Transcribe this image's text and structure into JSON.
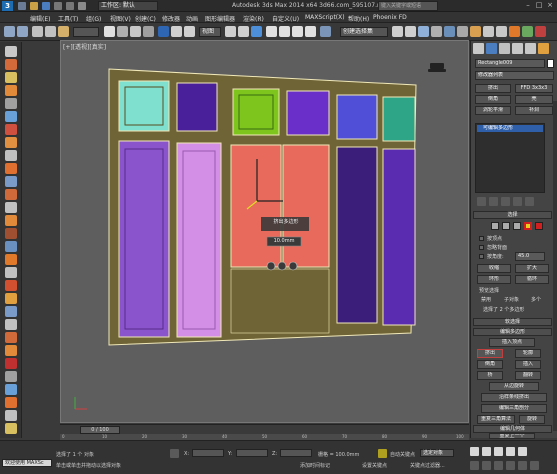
{
  "titlebar": {
    "logo": "3",
    "workspace": "工作区: 默认",
    "title": "Autodesk 3ds Max  2014 x64    3d66.com_595107.max",
    "search": "键入关键字或短语",
    "min": "–",
    "max": "□",
    "close": "×"
  },
  "menu": [
    "编辑(E)",
    "工具(T)",
    "组(G)",
    "视图(V)",
    "创建(C)",
    "修改器",
    "动画",
    "图形编辑器",
    "渲染(R)",
    "自定义(U)",
    "MAXScript(X)",
    "帮助(H)",
    "Phoenix FD"
  ],
  "toolbar": {
    "ref_coord": "视图",
    "selection_set": "创建选择集"
  },
  "viewport": {
    "label": "[+][透视][真实]",
    "caddy_title": "挤出多边形",
    "caddy_value": "10.0mm"
  },
  "command_panel": {
    "object_name": "Rectangle009",
    "modifier_list": "修改器列表",
    "btn_extrude": "挤出",
    "btn_ffd": "FFD 3x3x3",
    "btn_bevel": "倒角",
    "btn_slice": "壳",
    "btn_turbosmooth": "涡轮平滑",
    "btn_symmetry": "补洞",
    "stack_item": "可编辑多边形",
    "selection_title": "选择",
    "by_vertex": "按顶点",
    "ignore_backfacing": "忽略背面",
    "by_angle": "按角度:",
    "angle_value": "45.0",
    "shrink": "收缩",
    "grow": "扩大",
    "ring": "环形",
    "loop": "循环",
    "preview_selection": "预览选择",
    "preview_disabled": "禁用",
    "preview_subobj": "子对象",
    "preview_multi": "多个",
    "selected_text": "选择了 2 个多边形",
    "soft_selection": "软选择",
    "edit_polygons": "编辑多边形",
    "insert_vertex": "插入顶点",
    "extrude": "挤出",
    "outline": "轮廓",
    "bevel": "倒角",
    "inset": "插入",
    "bridge": "桥",
    "flip": "翻转",
    "hinge": "从边旋转",
    "extrude_spline": "沿样条线挤出",
    "edit_triangulation": "编辑三角剖分",
    "retriangulate": "重复三角算法",
    "turn": "旋转",
    "edit_geometry": "编辑几何体",
    "repeat_last": "重复上一个"
  },
  "timeline": {
    "frame": "0 / 100",
    "ticks": [
      "0",
      "10",
      "20",
      "30",
      "40",
      "50",
      "60",
      "70",
      "80",
      "90",
      "100"
    ]
  },
  "status": {
    "welcome": "欢迎使用 MAXSc",
    "selected": "选择了 1 个 对象",
    "hint": "单击或单击并拖动以选择对象",
    "x_label": "X:",
    "y_label": "Y:",
    "z_label": "Z:",
    "grid": "栅格 = 100.0mm",
    "add_time_tag": "添加时间标记",
    "auto_key": "自动关键点",
    "selected_obj": "选定对象",
    "set_key": "设置关键点",
    "key_filters": "关键点过滤器..."
  },
  "colors": {
    "panel_teal": "#7fe0cf",
    "panel_indigo": "#4a1f9a",
    "panel_lime": "#7ec51e",
    "panel_violet": "#6a2fc8",
    "panel_blue": "#4f4fd8",
    "panel_emerald": "#2fa588",
    "door_purple": "#8a55cc",
    "door_lilac": "#d38ee6",
    "selection_red": "#e86a5c",
    "door_dark": "#3a1e7a",
    "door_mid": "#5a2cb0",
    "frame": "#6f6436"
  }
}
